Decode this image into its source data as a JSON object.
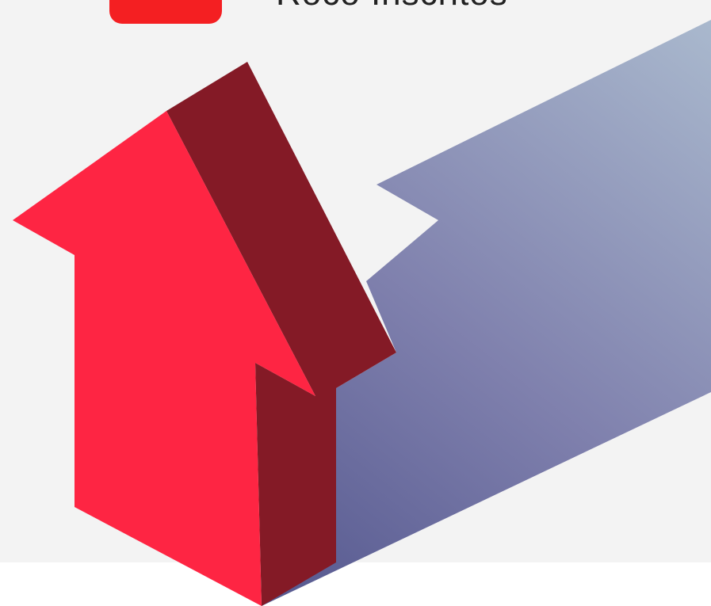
{
  "header": {
    "brand_text": "Roco Inscritos",
    "logo_name": "youtube-logo-icon"
  },
  "illustration": {
    "subject": "arrow-up-icon",
    "colors": {
      "background": "#f3f3f3",
      "arrow_front": "#fe2543",
      "arrow_side": "#841a26",
      "shadow_light": "#a9b8cd",
      "shadow_dark": "#5b5e94",
      "logo_red": "#f41f22"
    }
  }
}
